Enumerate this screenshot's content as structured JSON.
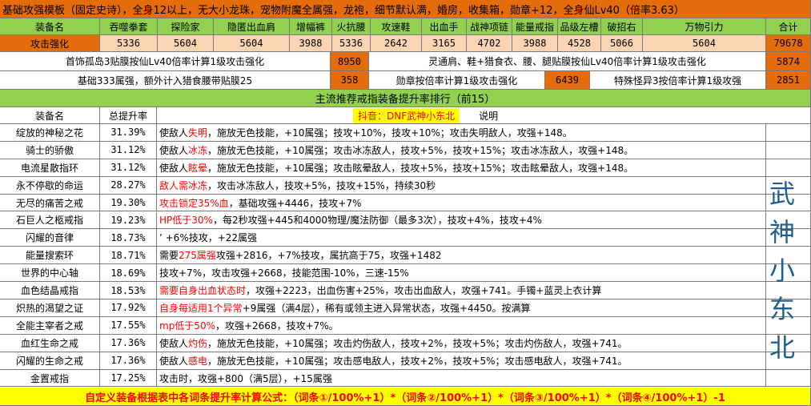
{
  "header": {
    "title": "基础攻强模板（固定史诗），全身12以上，无大小龙珠，宠物附魔全属强，龙袍，细节默认满，婚房，收集箱，勋章+12，全身仙Lv40（倍率3.63）"
  },
  "equip_table": {
    "headers": [
      "装备名",
      "吞噬拳套",
      "探险家",
      "隐匿出血肩",
      "增幅裤",
      "火抗腰",
      "攻速鞋",
      "出血手",
      "战神项链",
      "能量戒指",
      "品级左槽",
      "破招右",
      "万物引力",
      "合计"
    ],
    "row_label": "攻击强化",
    "values": [
      "5336",
      "5604",
      "5604",
      "3988",
      "5336",
      "2642",
      "3165",
      "4702",
      "3988",
      "4528",
      "5066",
      "5604",
      "79678"
    ]
  },
  "info_rows": {
    "r1_label": "首饰孤岛3贴膜按仙Lv40倍率计算1级攻击强化",
    "r1_value": "8950",
    "r1_label2": "灵通肩、鞋+猎食衣、腰、腿贴膜按仙Lv40倍率计算1级攻击强化",
    "r1_value2": "5874",
    "r2_label": "基础333属强，额外计入猎食腰带贴膜25",
    "r2_value": "358",
    "r2_label2": "勋章按倍率计算1级攻击强化",
    "r2_value2": "6439",
    "r2_label3": "特殊怪异3按倍率计算1级攻强",
    "r2_value3": "2851"
  },
  "ranking": {
    "title": "主流推荐戒指装备提升率排行（前15）",
    "col_name": "装备名",
    "col_rate": "总提升率",
    "col_note": "说明",
    "promo": "抖音：DNF武神小东北",
    "rows": [
      {
        "name": "绽放的神秘之花",
        "rate": "31.39%",
        "red": "",
        "pre": "使敌人",
        "red_mid": "失明",
        "rest": "，施放无色技能，+10属强；技攻+10%，技攻+10%；攻击失明敌人，攻强+148。"
      },
      {
        "name": "骑士的骄傲",
        "rate": "31.12%",
        "red": "",
        "pre": "使敌人",
        "red_mid": "冰冻",
        "rest": "，施放无色技能，+10属强；攻击冰冻敌人，技攻+5%，技攻+15%；攻击冰冻敌人，攻强+148。"
      },
      {
        "name": "电流星散指环",
        "rate": "31.12%",
        "red": "",
        "pre": "使敌人",
        "red_mid": "眩晕",
        "rest": "，施放无色技能，+10属强；攻击眩晕敌人，技攻+5%，技攻+15%；攻击眩晕敌人，攻强+148。"
      },
      {
        "name": "永不停歇的命运",
        "rate": "28.27%",
        "red": "敌人需冰冻",
        "pre": "",
        "red_mid": "",
        "rest": "，攻击冰冻敌人，技攻+5%，技攻+15%，持续30秒"
      },
      {
        "name": "无尽的痛苦之戒",
        "rate": "19.30%",
        "red": "攻击锁定35%血",
        "pre": "",
        "red_mid": "",
        "rest": "，基础攻强+4446，技攻+7%"
      },
      {
        "name": "石巨人之柩戒指",
        "rate": "19.23%",
        "red": "HP低于30%",
        "pre": "",
        "red_mid": "",
        "rest": "，每2秒攻强+445和4000物理/魔法防御（最多3次），技攻+4%，技攻+4%"
      },
      {
        "name": "闪耀的音律",
        "rate": "18.73%",
        "red": "",
        "pre": "",
        "red_mid": "",
        "rest": "’ +6%技攻，+22属强"
      },
      {
        "name": "能量搜索环",
        "rate": "18.71%",
        "red": "",
        "pre": "需要",
        "red_mid": "275属强",
        "rest": "攻强+2816，+7%技攻，属抗高于75，攻强+1482"
      },
      {
        "name": "世界的中心轴",
        "rate": "18.69%",
        "red": "",
        "pre": "",
        "red_mid": "",
        "rest": "技攻+7%，攻击攻强+2668，技能范围-10%，三速-15%"
      },
      {
        "name": "血色结晶戒指",
        "rate": "18.53%",
        "red": "需要自身出血状态时",
        "pre": "",
        "red_mid": "",
        "rest": "，攻强+2223，出血伤害+25%，攻击出血敌人，攻强+741。手镯+蓝灵上衣计算"
      },
      {
        "name": "炽热的渴望之证",
        "rate": "17.92%",
        "red": "自身每适用1个异常",
        "pre": "",
        "red_mid": "",
        "rest": "+9属强（满4层），稀有或领主进入异常状态，攻强+4450。按满算"
      },
      {
        "name": "全能主宰者之戒",
        "rate": "17.55%",
        "red": "mp低于50%",
        "pre": "",
        "red_mid": "",
        "rest": "，攻强+2668，技攻+7%。"
      },
      {
        "name": "血红生命之戒",
        "rate": "17.36%",
        "red": "",
        "pre": "使敌人",
        "red_mid": "灼伤",
        "rest": "，施放无色技能，+10属强；攻击灼伤敌人，技攻+2%，技攻+5%；攻击灼伤敌人，攻强+741。"
      },
      {
        "name": "闪耀的生命之戒",
        "rate": "17.36%",
        "red": "",
        "pre": "使敌人",
        "red_mid": "感电",
        "rest": "，施放无色技能，+10属强；攻击感电敌人，技攻+2%，技攻+5%；攻击感电敌人，攻强+741。"
      },
      {
        "name": "金置戒指",
        "rate": "17.25%",
        "red": "",
        "pre": "",
        "red_mid": "",
        "rest": "攻击时，攻强+800（满5层），+15属强"
      }
    ]
  },
  "watermark": [
    "武",
    "神",
    "小",
    "东",
    "北"
  ],
  "footer": {
    "formula": "自定义装备根据表中各词条提升率计算公式：（词条①/100%+1）*（词条②/100%+1）*（词条③/100%+1）*（词条④/100%+1）-1"
  },
  "colors": {
    "orange": "#e46c0a",
    "peach": "#fbd4b4",
    "green": "#92d050",
    "yellow": "#ffff00",
    "red": "#ff0000",
    "watermark": "#1f5f8b"
  }
}
